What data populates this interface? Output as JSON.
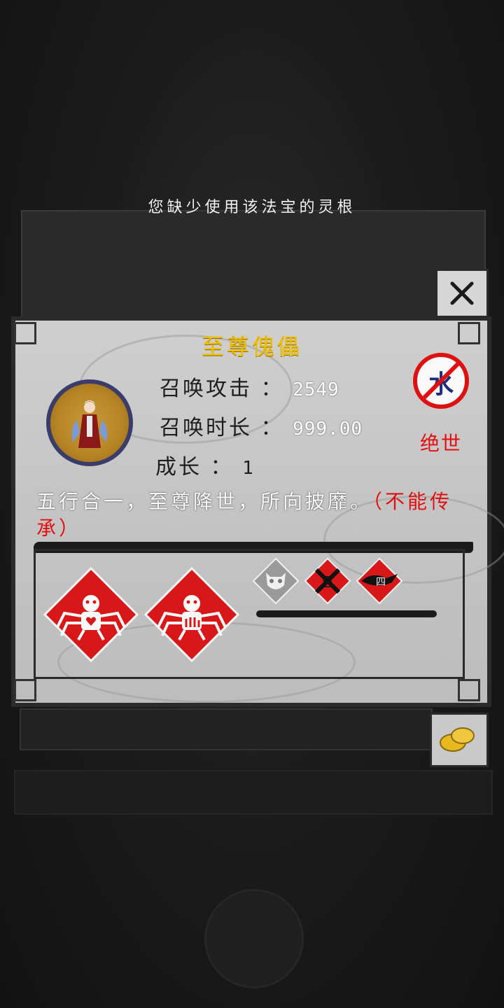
{
  "toast": {
    "text": "您缺少使用该法宝的灵根"
  },
  "item": {
    "name": "至尊傀儡",
    "stats": [
      {
        "label": "召唤攻击",
        "value": "2549"
      },
      {
        "label": "召唤时长",
        "value": "999.00"
      },
      {
        "label": "成长",
        "value": "1"
      }
    ],
    "element": "水",
    "rarity": "绝世",
    "description": "五行合一，至尊降世，所向披靡。",
    "description_note": "（不能传承）",
    "skills": [
      {
        "icon": "spider-heart-icon"
      },
      {
        "icon": "spider-fist-icon"
      }
    ],
    "small_skills": [
      {
        "icon": "demon-face-icon",
        "label": ""
      },
      {
        "icon": "crossed-five-icon",
        "label": "五"
      },
      {
        "icon": "fish-four-icon",
        "label": "四"
      }
    ]
  },
  "colors": {
    "title": "#f0c000",
    "rarity": "#e01010",
    "skill_red": "#d81818",
    "frame": "#2a2a2a"
  }
}
